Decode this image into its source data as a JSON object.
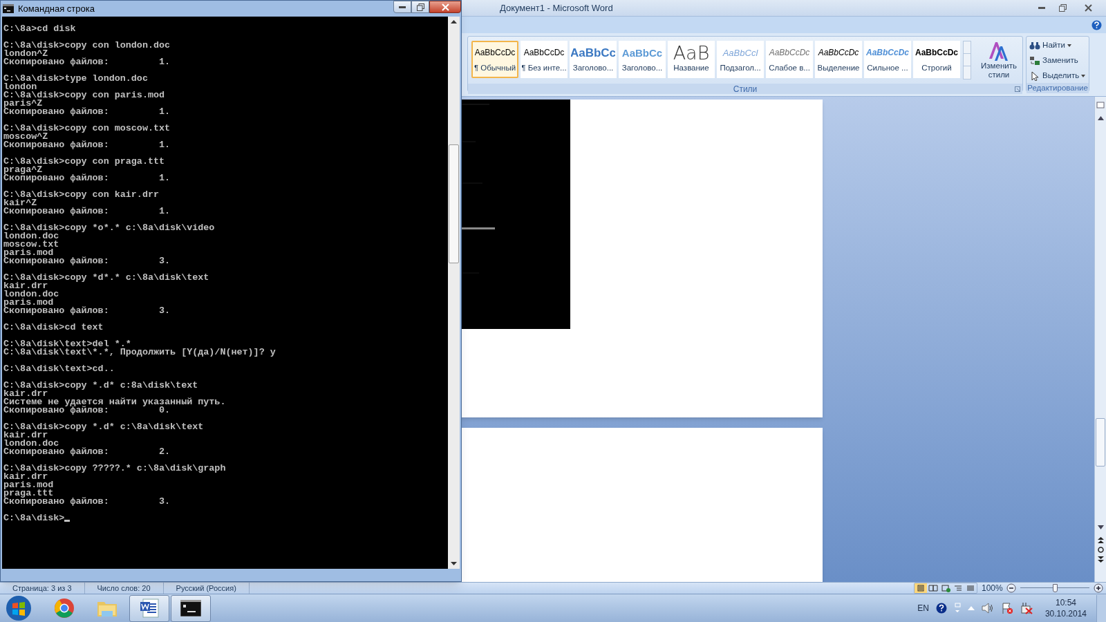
{
  "console": {
    "title": "Командная строка",
    "blocks": [
      [
        "C:\\8a>cd disk"
      ],
      [
        "C:\\8a\\disk>copy con london.doc",
        "london^Z",
        "Скопировано файлов:         1."
      ],
      [
        "C:\\8a\\disk>type london.doc",
        "london",
        "C:\\8a\\disk>copy con paris.mod",
        "paris^Z",
        "Скопировано файлов:         1."
      ],
      [
        "C:\\8a\\disk>copy con moscow.txt",
        "moscow^Z",
        "Скопировано файлов:         1."
      ],
      [
        "C:\\8a\\disk>copy con praga.ttt",
        "praga^Z",
        "Скопировано файлов:         1."
      ],
      [
        "C:\\8a\\disk>copy con kair.drr",
        "kair^Z",
        "Скопировано файлов:         1."
      ],
      [
        "C:\\8a\\disk>copy *o*.* c:\\8a\\disk\\video",
        "london.doc",
        "moscow.txt",
        "paris.mod",
        "Скопировано файлов:         3."
      ],
      [
        "C:\\8a\\disk>copy *d*.* c:\\8a\\disk\\text",
        "kair.drr",
        "london.doc",
        "paris.mod",
        "Скопировано файлов:         3."
      ],
      [
        "C:\\8a\\disk>cd text"
      ],
      [
        "C:\\8a\\disk\\text>del *.*",
        "C:\\8a\\disk\\text\\*.*, Продолжить [Y(да)/N(нет)]? y"
      ],
      [
        "C:\\8a\\disk\\text>cd.."
      ],
      [
        "C:\\8a\\disk>copy *.d* c:8a\\disk\\text",
        "kair.drr",
        "Системе не удается найти указанный путь.",
        "Скопировано файлов:         0."
      ],
      [
        "C:\\8a\\disk>copy *.d* c:\\8a\\disk\\text",
        "kair.drr",
        "london.doc",
        "Скопировано файлов:         2."
      ],
      [
        "C:\\8a\\disk>copy ?????.* c:\\8a\\disk\\graph",
        "kair.drr",
        "paris.mod",
        "praga.ttt",
        "Скопировано файлов:         3."
      ],
      [
        "C:\\8a\\disk>"
      ]
    ],
    "cursor": true
  },
  "word": {
    "title": "Документ1 - Microsoft Word",
    "styles": [
      {
        "preview": "AaBbCcDc",
        "name": "¶ Обычный",
        "kind": "normal",
        "selected": true
      },
      {
        "preview": "AaBbCcDc",
        "name": "¶ Без инте...",
        "kind": "normal",
        "selected": false
      },
      {
        "preview": "AaBbCc",
        "name": "Заголово...",
        "kind": "heading1",
        "selected": false
      },
      {
        "preview": "AaBbCc",
        "name": "Заголово...",
        "kind": "heading2",
        "selected": false
      },
      {
        "preview": "AaB",
        "name": "Название",
        "kind": "title",
        "selected": false
      },
      {
        "preview": "AaBbCcl",
        "name": "Подзагол...",
        "kind": "subtitle",
        "selected": false
      },
      {
        "preview": "AaBbCcDc",
        "name": "Слабое в...",
        "kind": "subtle",
        "selected": false
      },
      {
        "preview": "AaBbCcDc",
        "name": "Выделение",
        "kind": "emphasis",
        "selected": false
      },
      {
        "preview": "AaBbCcDc",
        "name": "Сильное ...",
        "kind": "intense",
        "selected": false
      },
      {
        "preview": "AaBbCcDc",
        "name": "Строгий",
        "kind": "strong",
        "selected": false
      }
    ],
    "change_styles": "Изменить стили",
    "styles_group": "Стили",
    "editing": [
      {
        "label": "Найти",
        "kind": "find"
      },
      {
        "label": "Заменить",
        "kind": "replace"
      },
      {
        "label": "Выделить",
        "kind": "select"
      }
    ],
    "editing_group": "Редактирование",
    "status": [
      "Страница: 3 из 3",
      "Число слов: 20",
      "Русский (Россия)"
    ],
    "zoom": "100%",
    "zoom_slider": {
      "level": 0.5
    }
  },
  "taskbar": {
    "apps": [
      {
        "kind": "chrome",
        "active": false
      },
      {
        "kind": "explorer",
        "active": false
      },
      {
        "kind": "word",
        "active": true
      },
      {
        "kind": "cmd",
        "active": true
      }
    ],
    "language": "EN",
    "time": "10:54",
    "date": "30.10.2014"
  }
}
